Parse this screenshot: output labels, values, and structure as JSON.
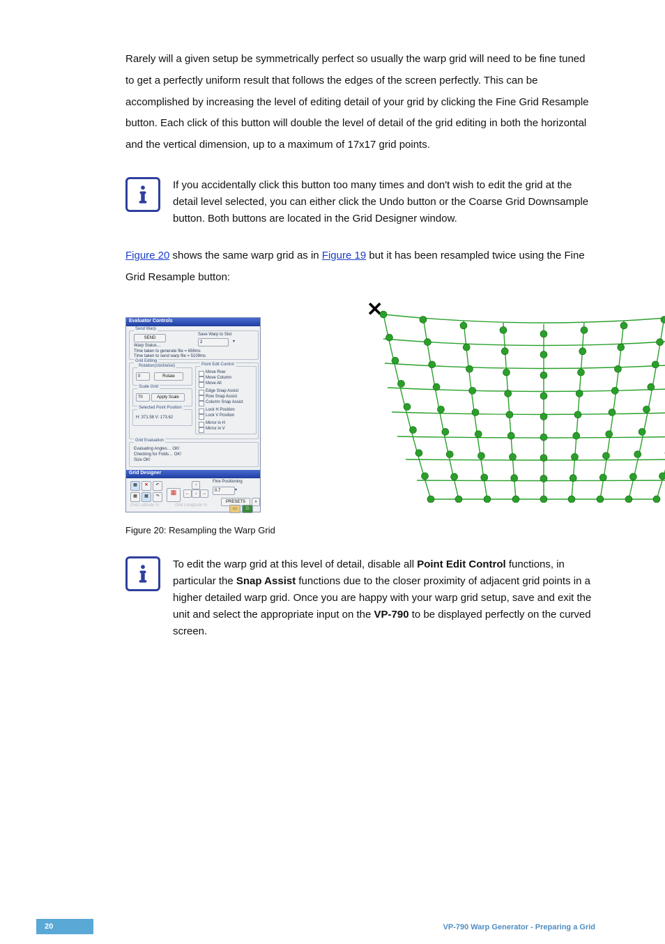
{
  "para1": "Rarely will a given setup be symmetrically perfect so usually the warp grid will need to be fine tuned to get a perfectly uniform result that follows the edges of the screen perfectly. This can be accomplished by increasing the level of editing detail of your grid by clicking the Fine Grid Resample button. Each click of this button will double the level of detail of the grid editing in both the horizontal and the vertical dimension, up to a maximum of 17x17 grid points.",
  "tip1": "If you accidentally click this button too many times and don't wish to edit the grid at the detail level selected, you can either click the Undo button or the Coarse Grid Downsample button. Both buttons are located in the Grid Designer window.",
  "para2_a": "Figure 20",
  "para2_b": " shows the same warp grid as in ",
  "para2_c": "Figure 19",
  "para2_d": " but it has been resampled twice using the Fine Grid Resample button:",
  "panel": {
    "title": "Evaluator Controls",
    "sendwarp": "Send Warp",
    "send": "SEND",
    "savewarp": "Save Warp to Slot",
    "slot": "2",
    "warpstatus": "Warp Status…",
    "gen": "Time taken to generate file = 656ms",
    "sendt": "Time taken to send warp file = 5109ms",
    "gridedit": "Grid Editing",
    "rotation": "Rotation(clockwise)",
    "rotate": "Rotate",
    "rotval": "0",
    "scalegrid": "Scale Grid",
    "applyscale": "Apply Scale",
    "scaleval": "70",
    "selpoint": "Selected Point Position",
    "hpos": "H:  371.58    V:  173.62",
    "pec": "Point Edit Control",
    "moverow": "Move Row",
    "movecol": "Move Column",
    "moveall": "Move All",
    "esa": "Edge Snap Assist",
    "rsa": "Row Snap Assist",
    "csa": "Column Snap Assist",
    "lhp": "Lock H Position",
    "lvp": "Lock V Position",
    "mh": "Mirror in H",
    "mv": "Mirror in V",
    "geval": "Grid Evaluation",
    "ea": "Evaluating Angles… OK!",
    "cf": "Checking for Folds… OK!",
    "so": "Size OK!",
    "gd": "Grid Designer",
    "fp": "Fine Positioning",
    "fpv": "0.7",
    "presets": "PRESETS",
    "gl": "Grid Latitude %",
    "glo": "Grid Longitude %"
  },
  "caption": "Figure 20: Resampling the Warp Grid",
  "tip2_a": "To edit the warp grid at this level of detail, disable all ",
  "tip2_b": "Point Edit Control",
  "tip2_c": " functions, in particular the ",
  "tip2_d": "Snap Assist",
  "tip2_e": " functions due to the closer proximity of adjacent grid points in a higher detailed warp grid. Once you are happy with your warp grid setup, save and exit the unit and select the appropriate input on the ",
  "tip2_f": "VP-790",
  "tip2_g": " to be displayed perfectly on the curved screen.",
  "pagenum": "20",
  "foottitle": "VP-790 Warp Generator - Preparing a Grid"
}
